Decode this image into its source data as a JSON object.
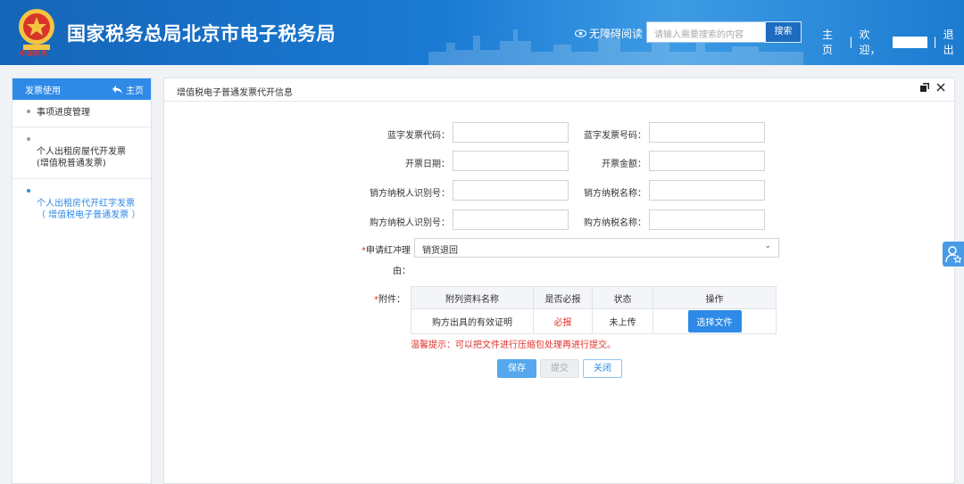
{
  "header": {
    "title": "国家税务总局北京市电子税务局",
    "logo_caption": "中国税务",
    "accessibility_label": "无障碍阅读",
    "search_placeholder": "请输入需要搜索的内容",
    "search_button": "搜索",
    "nav_home": "主页",
    "welcome": "欢迎，",
    "logout": "退出",
    "separator": "|"
  },
  "sidebar": {
    "title": "发票使用",
    "home_link": "主页",
    "items": [
      {
        "label": "事项进度管理",
        "active": false
      },
      {
        "label": "个人出租房屋代开发票\n(增值税普通发票)",
        "active": false
      },
      {
        "label": "个人出租房代开红字发票\n（ 增值税电子普通发票 ）",
        "active": true
      }
    ]
  },
  "panel": {
    "title": "增值税电子普通发票代开信息",
    "fields": {
      "blue_invoice_code": {
        "label": "蓝字发票代码：",
        "value": ""
      },
      "blue_invoice_number": {
        "label": "蓝字发票号码：",
        "value": ""
      },
      "issue_date": {
        "label": "开票日期：",
        "value": ""
      },
      "amount": {
        "label": "开票金额：",
        "value": ""
      },
      "seller_tax_id": {
        "label": "销方纳税人识别号：",
        "value": ""
      },
      "seller_name": {
        "label": "销方纳税名称：",
        "value": ""
      },
      "buyer_tax_id": {
        "label": "购方纳税人识别号：",
        "value": ""
      },
      "buyer_name": {
        "label": "购方纳税名称：",
        "value": ""
      }
    },
    "reason": {
      "required_mark": "*",
      "label_line1": "申请红冲理",
      "label_line2": "由：",
      "selected": "销货退回"
    },
    "attachments": {
      "required_mark": "*",
      "label": "附件：",
      "headers": [
        "附列资料名称",
        "是否必报",
        "状态",
        "操作"
      ],
      "rows": [
        {
          "name": "购方出具的有效证明",
          "required": "必报",
          "status": "未上传",
          "action": "选择文件"
        }
      ]
    },
    "hint": "温馨提示：可以把文件进行压缩包处理再进行提交。",
    "buttons": {
      "save": "保存",
      "submit": "提交",
      "close": "关闭"
    }
  },
  "colors": {
    "header_blue": "#1a7ad3",
    "accent": "#2e8ae6",
    "required_red": "#e0302a"
  }
}
